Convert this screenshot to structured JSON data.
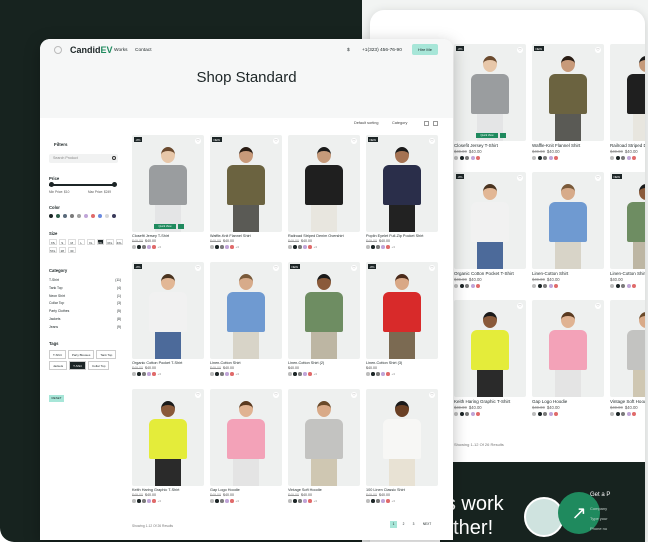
{
  "header": {
    "logo_text": "Candid",
    "logo_accent": "EV",
    "nav": [
      "Works",
      "Contact"
    ],
    "currency": "$",
    "phone": "+1(323) 456-76-90",
    "cta": "Hire Me"
  },
  "page_title": "Shop Standard",
  "sort": {
    "default": "Default sorting",
    "category": "Category"
  },
  "filters": {
    "title": "Filters",
    "search_placeholder": "Search Product",
    "price_label": "Price",
    "price_min": "Min Price: $10",
    "price_max": "Max Price: $249",
    "color_label": "Color",
    "colors": [
      "#1c2526",
      "#2f5e4a",
      "#5a6a7a",
      "#7a7a7a",
      "#a0a0a0",
      "#c0a5d8",
      "#e06a6a",
      "#6a8adf",
      "#d8d8d8",
      "#3a3a5a"
    ],
    "size_label": "Size",
    "sizes": [
      "XS",
      "S",
      "M",
      "L",
      "XL",
      "2XL",
      "3XL",
      "4XL",
      "5XL",
      "28",
      "30"
    ],
    "selected_size": "2XL",
    "category_label": "Category",
    "categories": [
      {
        "name": "T-Shirt",
        "count": "(11)"
      },
      {
        "name": "Tank Top",
        "count": "(4)"
      },
      {
        "name": "Neon Shirt",
        "count": "(1)"
      },
      {
        "name": "Collar Top",
        "count": "(3)"
      },
      {
        "name": "Party Clothes",
        "count": "(5)"
      },
      {
        "name": "Jackets",
        "count": "(8)"
      },
      {
        "name": "Jeans",
        "count": "(9)"
      }
    ],
    "tags_label": "Tags",
    "tags": [
      "T-Shirt",
      "Party Blouses",
      "Tank Top",
      "Jackets",
      "T-Shirt",
      "Collar Top"
    ],
    "selected_tag_index": 4,
    "reset": "RESET"
  },
  "products": [
    {
      "name": "Closefit Jersey T-Shirt",
      "old": "$49.00",
      "price": "$40.00",
      "badge": "-8%",
      "shirt": "#9a9d9f",
      "legs": "#e4e5e6",
      "skin": "#e7c7a9",
      "hair": "#6b4a2e",
      "quick": true
    },
    {
      "name": "Waffle-Knit Flannel Shirt",
      "old": "$49.00",
      "price": "$40.00",
      "badge": "NEW",
      "shirt": "#6b6340",
      "legs": "#5a5a55",
      "skin": "#c89a7a",
      "hair": "#2a1d14",
      "quick": false
    },
    {
      "name": "Railroad Striped Denim Overshirt",
      "old": "$49.00",
      "price": "$40.00",
      "badge": "",
      "shirt": "#1f1f1f",
      "legs": "#e8e6df",
      "skin": "#c59a7a",
      "hair": "#1a1a1a",
      "quick": false
    },
    {
      "name": "Poplin Eyelet Full-Zip Pocket Shirt",
      "old": "$49.00",
      "price": "$40.00",
      "badge": "NEW",
      "shirt": "#2a2e4a",
      "legs": "#222",
      "skin": "#a57353",
      "hair": "#1a1a1a",
      "quick": false
    },
    {
      "name": "Organic Cotton Pocket T-Shirt",
      "old": "$49.00",
      "price": "$40.00",
      "badge": "-8%",
      "shirt": "#f1f1f1",
      "legs": "#4c6a9a",
      "skin": "#e2b795",
      "hair": "#4a3420",
      "quick": false
    },
    {
      "name": "Linen-Cotton Shirt",
      "old": "$49.00",
      "price": "$40.00",
      "badge": "",
      "shirt": "#6f9ad1",
      "legs": "#d8d4c8",
      "skin": "#d7ab8a",
      "hair": "#7a5a3a",
      "quick": false
    },
    {
      "name": "Linen-Cotton Shirt (2)",
      "old": "",
      "price": "$40.00",
      "badge": "NEW",
      "shirt": "#6e8d62",
      "legs": "#bdb6a3",
      "skin": "#8a5a3a",
      "hair": "#1a1a1a",
      "quick": false
    },
    {
      "name": "Linen-Cotton Shirt (3)",
      "old": "",
      "price": "$40.00",
      "badge": "-8%",
      "shirt": "#d82a2a",
      "legs": "#7b6a52",
      "skin": "#d9a886",
      "hair": "#4a2a1a",
      "quick": false
    },
    {
      "name": "Keith Haring Graphic T-Shirt",
      "old": "$49.00",
      "price": "$40.00",
      "badge": "",
      "shirt": "#e4ec3a",
      "legs": "#2a2a2a",
      "skin": "#8a5a3a",
      "hair": "#1a1a1a",
      "quick": false
    },
    {
      "name": "Gap Logo Hoodie",
      "old": "$49.00",
      "price": "$40.00",
      "badge": "",
      "shirt": "#f3a2b8",
      "legs": "#e4e4e4",
      "skin": "#e0b392",
      "hair": "#5a3a20",
      "quick": false
    },
    {
      "name": "Vintage Soft Hoodie",
      "old": "$49.00",
      "price": "$40.00",
      "badge": "",
      "shirt": "#c3c3c1",
      "legs": "#cfc7b2",
      "skin": "#d9aa88",
      "hair": "#6a4a2a",
      "quick": false
    },
    {
      "name": "100 Linen Classic Shirt",
      "old": "$49.00",
      "price": "$40.00",
      "badge": "",
      "shirt": "#f7f7f5",
      "legs": "#e8e2d4",
      "skin": "#6a4024",
      "hair": "#1a1a1a",
      "quick": false
    }
  ],
  "swatches": [
    "#bdbdbd",
    "#1c2526",
    "#7a7a7a",
    "#c0a5d8",
    "#e06a6a"
  ],
  "swatch_more": "+3",
  "showing": "Showing 1-12 Of 26 Results",
  "pagination": [
    "1",
    "2",
    "3",
    "NEXT"
  ],
  "back_products": [
    {
      "name": "Closefit Jersey T-Shirt",
      "old": "$49.00",
      "price": "$40.00",
      "badge": "-8%",
      "shirt": "#9a9d9f",
      "legs": "#e4e5e6",
      "skin": "#e7c7a9",
      "hair": "#6b4a2e",
      "quick": true
    },
    {
      "name": "Waffle-Knit Flannel Shirt",
      "old": "$49.00",
      "price": "$40.00",
      "badge": "NEW",
      "shirt": "#6b6340",
      "legs": "#5a5a55",
      "skin": "#c89a7a",
      "hair": "#2a1d14",
      "quick": false
    },
    {
      "name": "Railroad Striped Denim Ove",
      "old": "$49.00",
      "price": "$40.00",
      "badge": "",
      "shirt": "#1f1f1f",
      "legs": "#e8e6df",
      "skin": "#c59a7a",
      "hair": "#1a1a1a",
      "quick": false
    },
    {
      "name": "Organic Cotton Pocket T-Shirt",
      "old": "$49.00",
      "price": "$40.00",
      "badge": "-8%",
      "shirt": "#f1f1f1",
      "legs": "#4c6a9a",
      "skin": "#e2b795",
      "hair": "#4a3420",
      "quick": false
    },
    {
      "name": "Linen-Cotton Shirt",
      "old": "$49.00",
      "price": "$40.00",
      "badge": "",
      "shirt": "#6f9ad1",
      "legs": "#d8d4c8",
      "skin": "#d7ab8a",
      "hair": "#7a5a3a",
      "quick": false
    },
    {
      "name": "Linen-Cotton Shirt",
      "old": "",
      "price": "$40.00",
      "badge": "NEW",
      "shirt": "#6e8d62",
      "legs": "#bdb6a3",
      "skin": "#8a5a3a",
      "hair": "#1a1a1a",
      "quick": false
    },
    {
      "name": "Keith Haring Graphic T-Shirt",
      "old": "$49.00",
      "price": "$40.00",
      "badge": "",
      "shirt": "#e4ec3a",
      "legs": "#2a2a2a",
      "skin": "#8a5a3a",
      "hair": "#1a1a1a",
      "quick": false
    },
    {
      "name": "Gap Logo Hoodie",
      "old": "$49.00",
      "price": "$40.00",
      "badge": "",
      "shirt": "#f3a2b8",
      "legs": "#e4e4e4",
      "skin": "#e0b392",
      "hair": "#5a3a20",
      "quick": false
    },
    {
      "name": "Vintage Soft Hood",
      "old": "$49.00",
      "price": "$40.00",
      "badge": "",
      "shirt": "#c3c3c1",
      "legs": "#cfc7b2",
      "skin": "#d9aa88",
      "hair": "#6a4a2a",
      "quick": false
    }
  ],
  "back_showing": "Showing 1-12 Of 26 Results",
  "back_quick_view": "Quick View",
  "quick_view": "Quick View",
  "footer": {
    "big_text_1": "'s work",
    "big_text_2": "ether!",
    "get_label": "Get a P",
    "sub": "Company",
    "field1": "Type your",
    "field2": "Phone nu"
  }
}
